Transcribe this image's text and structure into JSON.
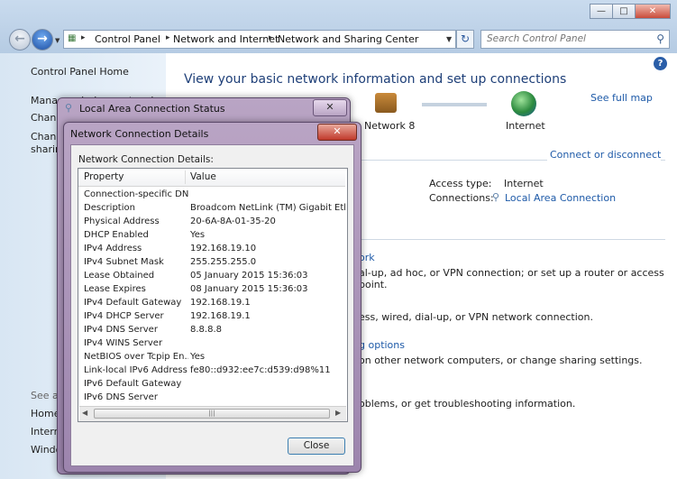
{
  "breadcrumb": [
    "Control Panel",
    "Network and Internet",
    "Network and Sharing Center"
  ],
  "search": {
    "placeholder": "Search Control Panel"
  },
  "sidebar": {
    "home": "Control Panel Home",
    "items": [
      "Manage wireless networks",
      "Change adapter settings",
      "Change advanced sharing settings"
    ],
    "see_also": "See also",
    "see_also_items": [
      "HomeGroup",
      "Internet Options",
      "Windows Firewall"
    ]
  },
  "main": {
    "heading": "View your basic network information and set up connections",
    "see_full_map": "See full map",
    "network_name": "Network 8",
    "internet": "Internet",
    "connect_disconnect": "Connect or disconnect",
    "access_type_label": "Access type:",
    "access_type_value": "Internet",
    "connections_label": "Connections:",
    "connections_value": "Local Area Connection",
    "frag1": "ork",
    "frag2": "al-up, ad hoc, or VPN connection; or set up a router or access point.",
    "frag3": "ess, wired, dial-up, or VPN network connection.",
    "frag4": "g options",
    "frag5": "on other network computers, or change sharing settings.",
    "frag6": "oblems, or get troubleshooting information."
  },
  "status_window": {
    "title": "Local Area Connection Status"
  },
  "details_window": {
    "title": "Network Connection Details",
    "label": "Network Connection Details:",
    "col_property": "Property",
    "col_value": "Value",
    "rows": [
      [
        "Connection-specific DN...",
        ""
      ],
      [
        "Description",
        "Broadcom NetLink (TM) Gigabit Ethernet"
      ],
      [
        "Physical Address",
        "20-6A-8A-01-35-20"
      ],
      [
        "DHCP Enabled",
        "Yes"
      ],
      [
        "IPv4 Address",
        "192.168.19.10"
      ],
      [
        "IPv4 Subnet Mask",
        "255.255.255.0"
      ],
      [
        "Lease Obtained",
        "05 January 2015 15:36:03"
      ],
      [
        "Lease Expires",
        "08 January 2015 15:36:03"
      ],
      [
        "IPv4 Default Gateway",
        "192.168.19.1"
      ],
      [
        "IPv4 DHCP Server",
        "192.168.19.1"
      ],
      [
        "IPv4 DNS Server",
        "8.8.8.8"
      ],
      [
        "IPv4 WINS Server",
        ""
      ],
      [
        "NetBIOS over Tcpip En...",
        "Yes"
      ],
      [
        "Link-local IPv6 Address",
        "fe80::d932:ee7c:d539:d98%11"
      ],
      [
        "IPv6 Default Gateway",
        ""
      ],
      [
        "IPv6 DNS Server",
        ""
      ]
    ],
    "close_label": "Close"
  },
  "icons": {
    "close": "close-icon",
    "help": "help-icon",
    "search": "search-icon"
  }
}
